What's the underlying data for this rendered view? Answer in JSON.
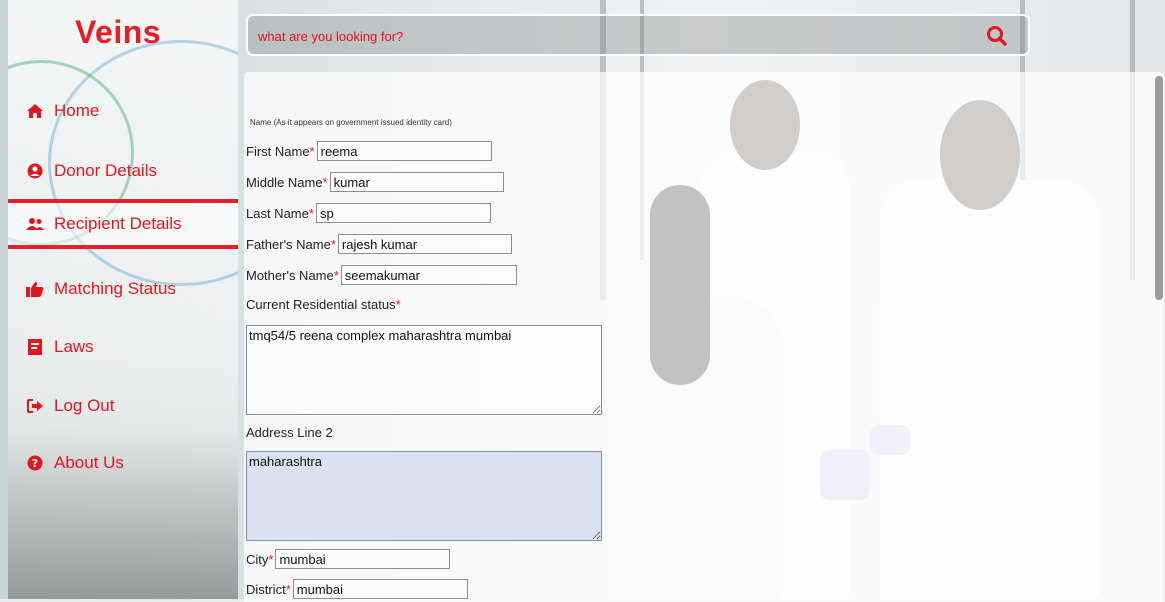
{
  "app": {
    "logo": "Veins"
  },
  "sidebar": {
    "items": [
      {
        "label": "Home",
        "icon": "home-icon"
      },
      {
        "label": "Donor Details",
        "icon": "user-circle-icon"
      },
      {
        "label": "Recipient Details",
        "icon": "users-icon",
        "active": true
      },
      {
        "label": "Matching Status",
        "icon": "thumbs-up-icon"
      },
      {
        "label": "Laws",
        "icon": "book-icon"
      },
      {
        "label": "Log Out",
        "icon": "sign-out-icon"
      },
      {
        "label": "About Us",
        "icon": "question-circle-icon"
      }
    ]
  },
  "search": {
    "placeholder": "what are you looking for?",
    "icon": "search-icon"
  },
  "form": {
    "caption": "Name (As it appears on government issued identity card)",
    "first_name": {
      "label": "First Name",
      "required_mark": "*",
      "value": "reema"
    },
    "middle_name": {
      "label": "Middle Name",
      "required_mark": "*",
      "value": "kumar"
    },
    "last_name": {
      "label": "Last Name",
      "required_mark": "*",
      "value": "sp"
    },
    "father_name": {
      "label": "Father's Name",
      "required_mark": "*",
      "value": "rajesh kumar"
    },
    "mother_name": {
      "label": "Mother's Name",
      "required_mark": "*",
      "value": "seemakumar"
    },
    "residential": {
      "label": "Current Residential status",
      "required_mark": "*",
      "value": "tmq54/5 reena complex maharashtra mumbai"
    },
    "address2": {
      "label": "Address Line 2",
      "value": "maharashtra"
    },
    "city": {
      "label": "City",
      "required_mark": "*",
      "value": "mumbai"
    },
    "district": {
      "label": "District",
      "required_mark": "*",
      "value": "mumbai"
    }
  },
  "colors": {
    "accent": "#e2161c",
    "active_border": "#e22228"
  }
}
